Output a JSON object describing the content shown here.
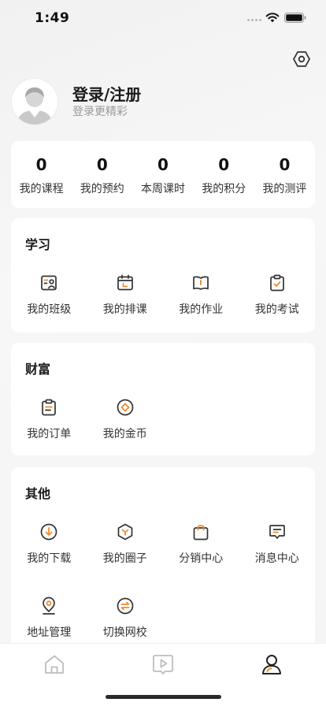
{
  "status_bar": {
    "time": "1:49"
  },
  "header": {
    "login_title": "登录/注册",
    "login_subtitle": "登录更精彩",
    "settings_icon": "settings-hexagon-icon"
  },
  "stats": [
    {
      "value": "0",
      "label": "我的课程"
    },
    {
      "value": "0",
      "label": "我的预约"
    },
    {
      "value": "0",
      "label": "本周课时"
    },
    {
      "value": "0",
      "label": "我的积分"
    },
    {
      "value": "0",
      "label": "我的测评"
    }
  ],
  "sections": {
    "learning": {
      "title": "学习",
      "items": [
        {
          "label": "我的班级",
          "icon": "class-icon"
        },
        {
          "label": "我的排课",
          "icon": "schedule-icon"
        },
        {
          "label": "我的作业",
          "icon": "homework-book-icon"
        },
        {
          "label": "我的考试",
          "icon": "exam-clipboard-icon"
        }
      ]
    },
    "wealth": {
      "title": "财富",
      "items": [
        {
          "label": "我的订单",
          "icon": "order-icon"
        },
        {
          "label": "我的金币",
          "icon": "coin-icon"
        }
      ]
    },
    "other": {
      "title": "其他",
      "items": [
        {
          "label": "我的下载",
          "icon": "download-icon"
        },
        {
          "label": "我的圈子",
          "icon": "circle-hexagon-icon"
        },
        {
          "label": "分销中心",
          "icon": "shopping-bag-icon"
        },
        {
          "label": "消息中心",
          "icon": "message-icon"
        },
        {
          "label": "地址管理",
          "icon": "location-pin-icon"
        },
        {
          "label": "切换网校",
          "icon": "switch-arrows-icon"
        }
      ]
    }
  },
  "tab_bar": {
    "tabs": [
      {
        "icon": "home-icon",
        "active": false
      },
      {
        "icon": "video-play-icon",
        "active": false
      },
      {
        "icon": "profile-icon",
        "active": true
      }
    ]
  },
  "colors": {
    "accent": "#f08a2c",
    "icon_dark": "#333333",
    "tab_inactive": "#bdbdbd",
    "card_bg": "#ffffff",
    "page_bg": "#f4f4f4"
  }
}
